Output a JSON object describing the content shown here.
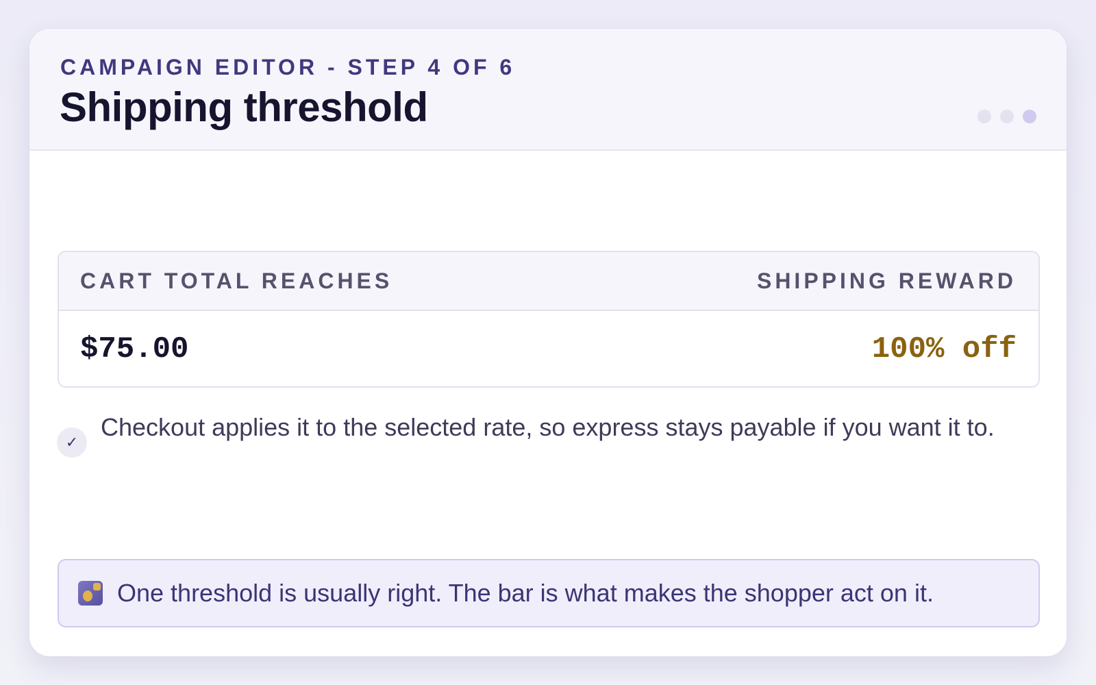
{
  "header": {
    "eyebrow": "CAMPAIGN EDITOR - STEP 4 OF 6",
    "title": "Shipping threshold"
  },
  "rule_table": {
    "col_condition": "CART TOTAL REACHES",
    "col_reward": "SHIPPING REWARD",
    "threshold": "$75.00",
    "reward": "100% off"
  },
  "note": {
    "text": "Checkout applies it to the selected rate, so express stays payable if you want it to."
  },
  "tip": {
    "icon": "gift-box-icon",
    "text": "One threshold is usually right. The bar is what makes the shopper act on it."
  },
  "colors": {
    "accent": "#40397f",
    "reward": "#8a6210",
    "tip_background": "#f0eefb"
  }
}
